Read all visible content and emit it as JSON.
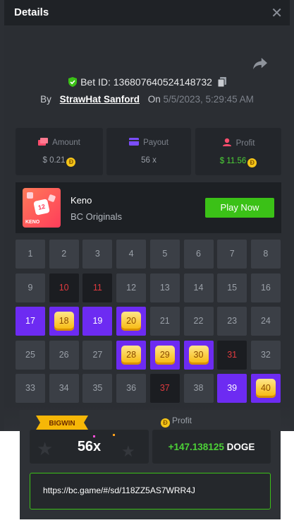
{
  "header": {
    "title": "Details",
    "close_glyph": "✕"
  },
  "bet": {
    "id_label": "Bet ID:",
    "id": "136807640524148732"
  },
  "byline": {
    "by": "By",
    "user": "StrawHat Sanford",
    "on": "On",
    "datetime": "5/5/2023, 5:29:45 AM"
  },
  "stats": {
    "amount": {
      "label": "Amount",
      "value": "$ 0.21"
    },
    "payout": {
      "label": "Payout",
      "value": "56 x"
    },
    "profit": {
      "label": "Profit",
      "value": "$ 11.56"
    }
  },
  "game": {
    "name": "Keno",
    "provider": "BC Originals",
    "play_label": "Play Now",
    "thumb_number": "12",
    "thumb_text": "KENO"
  },
  "grid": {
    "columns": 8,
    "tiles": [
      {
        "n": "1",
        "s": "normal"
      },
      {
        "n": "2",
        "s": "normal"
      },
      {
        "n": "3",
        "s": "normal"
      },
      {
        "n": "4",
        "s": "normal"
      },
      {
        "n": "5",
        "s": "normal"
      },
      {
        "n": "6",
        "s": "normal"
      },
      {
        "n": "7",
        "s": "normal"
      },
      {
        "n": "8",
        "s": "normal"
      },
      {
        "n": "9",
        "s": "normal"
      },
      {
        "n": "10",
        "s": "dark"
      },
      {
        "n": "11",
        "s": "dark"
      },
      {
        "n": "12",
        "s": "normal"
      },
      {
        "n": "13",
        "s": "normal"
      },
      {
        "n": "14",
        "s": "normal"
      },
      {
        "n": "15",
        "s": "normal"
      },
      {
        "n": "16",
        "s": "normal"
      },
      {
        "n": "17",
        "s": "purple"
      },
      {
        "n": "18",
        "s": "hit"
      },
      {
        "n": "19",
        "s": "purple"
      },
      {
        "n": "20",
        "s": "hit"
      },
      {
        "n": "21",
        "s": "normal"
      },
      {
        "n": "22",
        "s": "normal"
      },
      {
        "n": "23",
        "s": "normal"
      },
      {
        "n": "24",
        "s": "normal"
      },
      {
        "n": "25",
        "s": "normal"
      },
      {
        "n": "26",
        "s": "normal"
      },
      {
        "n": "27",
        "s": "normal"
      },
      {
        "n": "28",
        "s": "hit"
      },
      {
        "n": "29",
        "s": "hit"
      },
      {
        "n": "30",
        "s": "hit"
      },
      {
        "n": "31",
        "s": "dark"
      },
      {
        "n": "32",
        "s": "normal"
      },
      {
        "n": "33",
        "s": "normal"
      },
      {
        "n": "34",
        "s": "normal"
      },
      {
        "n": "35",
        "s": "normal"
      },
      {
        "n": "36",
        "s": "normal"
      },
      {
        "n": "37",
        "s": "dark"
      },
      {
        "n": "38",
        "s": "normal"
      },
      {
        "n": "39",
        "s": "purple"
      },
      {
        "n": "40",
        "s": "hit"
      }
    ]
  },
  "result": {
    "badge": "BIGWIN",
    "profit_label": "Profit",
    "multiplier": "56x",
    "profit_amount": "+147.138125",
    "currency": "DOGE"
  },
  "share_link": {
    "url": "https://bc.game/#/sd/118ZZ5AS7WRR4J"
  },
  "colors": {
    "accent_green": "#3bc117",
    "purple": "#6d2bf2",
    "gold": "#f6b707",
    "loss_red": "#e03a3e"
  }
}
